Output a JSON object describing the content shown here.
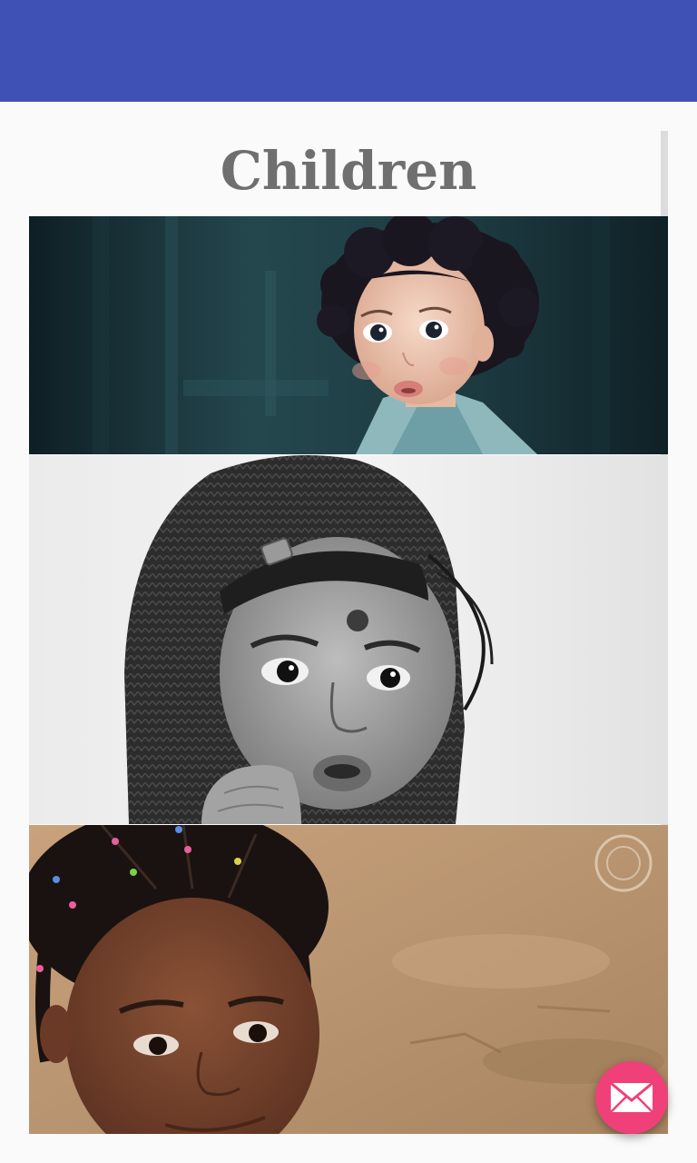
{
  "app_bar": {
    "color": "#3f51b5"
  },
  "page": {
    "title": "Children"
  },
  "gallery": {
    "images": [
      {
        "name": "child-curly-hair-photo"
      },
      {
        "name": "child-knit-hood-photo"
      },
      {
        "name": "child-braided-hair-photo"
      }
    ]
  },
  "fab": {
    "icon": "mail-icon",
    "color": "#f0407a"
  }
}
